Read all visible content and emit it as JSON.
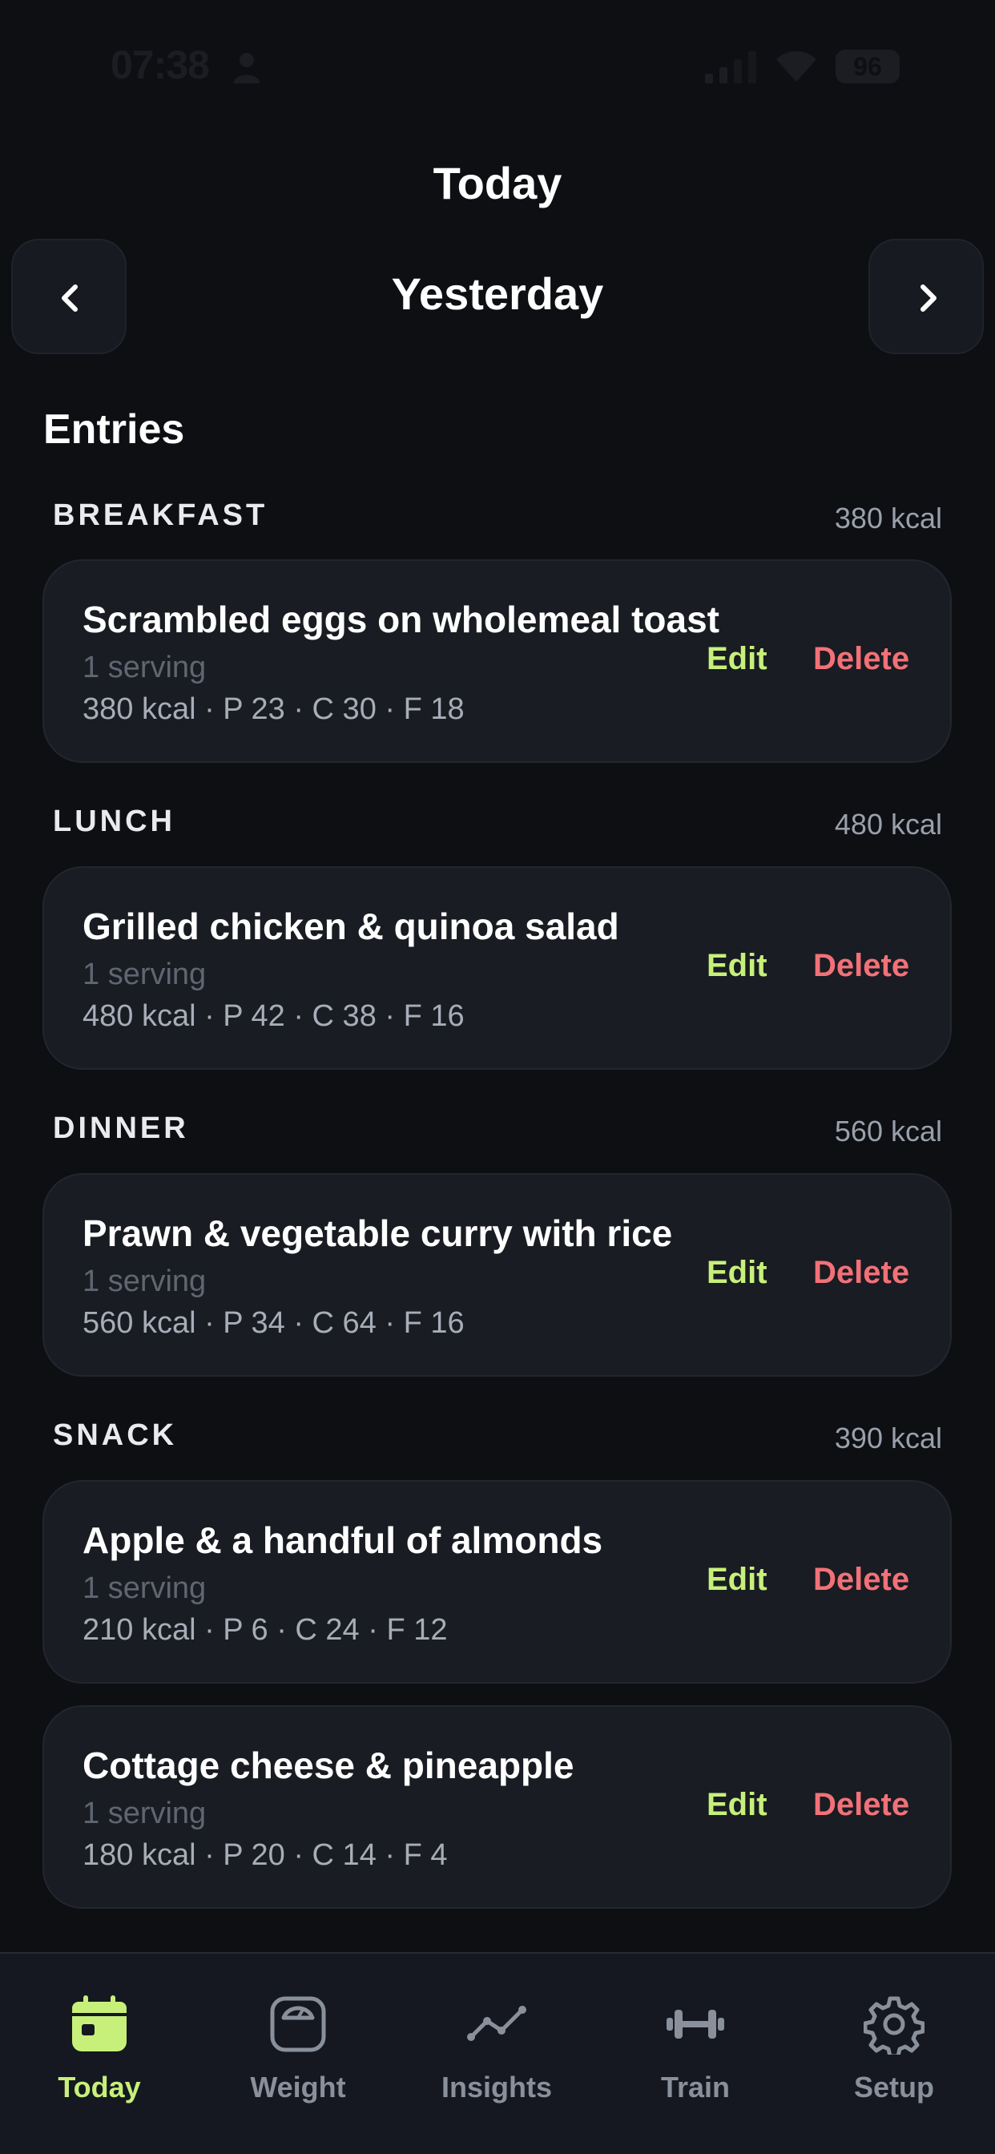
{
  "status_bar": {
    "time": "07:38",
    "battery": "96"
  },
  "header": {
    "title": "Today",
    "day": "Yesterday"
  },
  "entries_section": {
    "title": "Entries"
  },
  "meals": [
    {
      "name": "BREAKFAST",
      "kcal": "380 kcal",
      "items": [
        {
          "name": "Scrambled eggs on wholemeal toast",
          "serving": "1 serving",
          "macros": "380 kcal · P 23 · C 30 · F 18",
          "edit": "Edit",
          "delete": "Delete"
        }
      ]
    },
    {
      "name": "LUNCH",
      "kcal": "480 kcal",
      "items": [
        {
          "name": "Grilled chicken & quinoa salad",
          "serving": "1 serving",
          "macros": "480 kcal · P 42 · C 38 · F 16",
          "edit": "Edit",
          "delete": "Delete"
        }
      ]
    },
    {
      "name": "DINNER",
      "kcal": "560 kcal",
      "items": [
        {
          "name": "Prawn & vegetable curry with rice",
          "serving": "1 serving",
          "macros": "560 kcal · P 34 · C 64 · F 16",
          "edit": "Edit",
          "delete": "Delete"
        }
      ]
    },
    {
      "name": "SNACK",
      "kcal": "390 kcal",
      "items": [
        {
          "name": "Apple & a handful of almonds",
          "serving": "1 serving",
          "macros": "210 kcal · P 6 · C 24 · F 12",
          "edit": "Edit",
          "delete": "Delete"
        },
        {
          "name": "Cottage cheese & pineapple",
          "serving": "1 serving",
          "macros": "180 kcal · P 20 · C 14 · F 4",
          "edit": "Edit",
          "delete": "Delete"
        }
      ]
    }
  ],
  "tab_bar": {
    "tabs": [
      {
        "label": "Today",
        "icon": "calendar-icon",
        "active": true
      },
      {
        "label": "Weight",
        "icon": "scale-icon",
        "active": false
      },
      {
        "label": "Insights",
        "icon": "trend-line-icon",
        "active": false
      },
      {
        "label": "Train",
        "icon": "dumbbell-icon",
        "active": false
      },
      {
        "label": "Setup",
        "icon": "gear-icon",
        "active": false
      }
    ]
  },
  "colors": {
    "background": "#0d0f13",
    "card": "#191c22",
    "accent": "#c7f07a",
    "danger": "#f27178",
    "muted": "#8a909b"
  }
}
